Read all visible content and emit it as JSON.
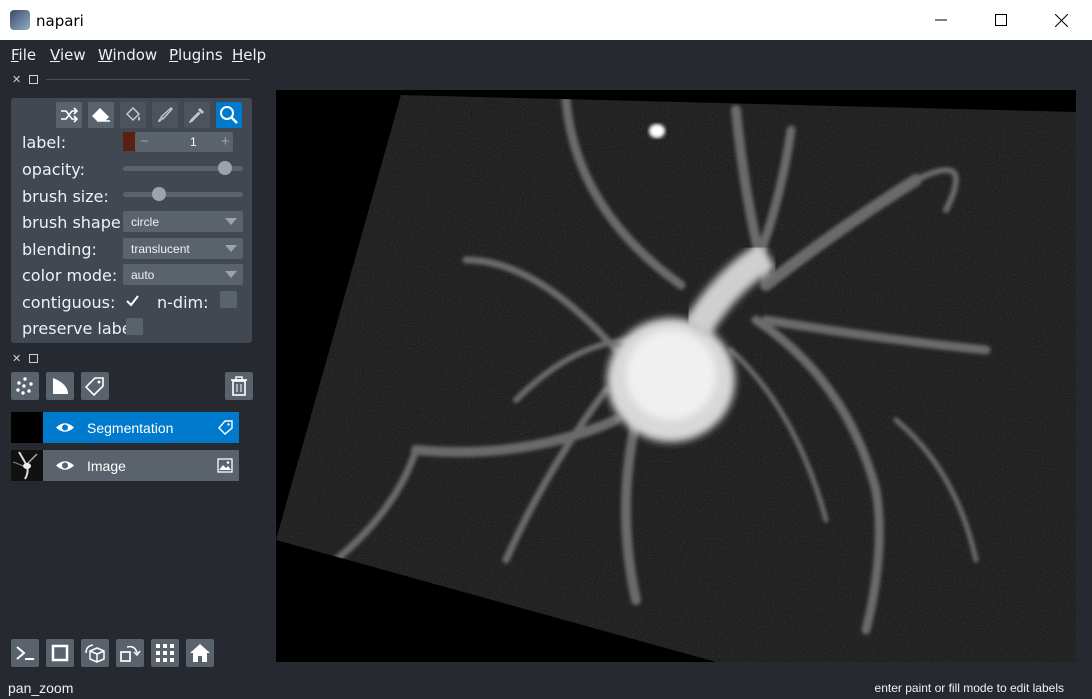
{
  "window": {
    "title": "napari"
  },
  "menu": [
    {
      "u": "F",
      "rest": "ile"
    },
    {
      "u": "V",
      "rest": "iew"
    },
    {
      "u": "W",
      "rest": "indow"
    },
    {
      "u": "P",
      "rest": "lugins"
    },
    {
      "u": "H",
      "rest": "elp"
    }
  ],
  "controls": {
    "label": "label:",
    "label_value": "1",
    "label_color": "#5a2014",
    "opacity": "opacity:",
    "opacity_value": 0.9,
    "brush_size": "brush size:",
    "brush_size_value": 0.27,
    "brush_shape": "brush shape",
    "brush_shape_value": "circle",
    "blending": "blending:",
    "blending_value": "translucent",
    "color_mode": "color mode:",
    "color_mode_value": "auto",
    "contiguous": "contiguous:",
    "ndim": "n-dim:",
    "preserve": "preserve labe"
  },
  "layers": [
    {
      "name": "Segmentation",
      "selected": true
    },
    {
      "name": "Image",
      "selected": false
    }
  ],
  "status": {
    "left": "pan_zoom",
    "right": "enter paint or fill mode to edit labels"
  },
  "colors": {
    "accent": "#007acc",
    "panel": "#414851",
    "background": "#262930"
  }
}
